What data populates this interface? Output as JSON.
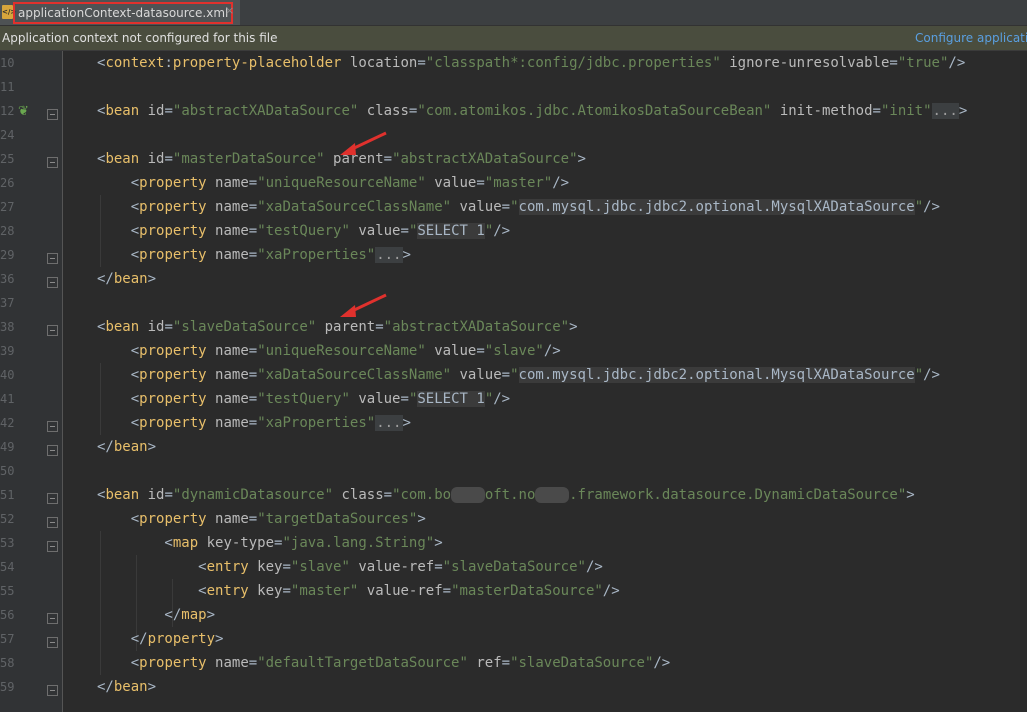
{
  "tab": {
    "icon": "xml-file-icon",
    "title": "applicationContext-datasource.xml",
    "close": "×"
  },
  "notice": {
    "text": "Application context not configured for this file",
    "link": "Configure applicatio"
  },
  "lines": [
    {
      "num": "10"
    },
    {
      "num": "11"
    },
    {
      "num": "12"
    },
    {
      "num": "24"
    },
    {
      "num": "25"
    },
    {
      "num": "26"
    },
    {
      "num": "27"
    },
    {
      "num": "28"
    },
    {
      "num": "29"
    },
    {
      "num": "36"
    },
    {
      "num": "37"
    },
    {
      "num": "38"
    },
    {
      "num": "39"
    },
    {
      "num": "40"
    },
    {
      "num": "41"
    },
    {
      "num": "42"
    },
    {
      "num": "49"
    },
    {
      "num": "50"
    },
    {
      "num": "51"
    },
    {
      "num": "52"
    },
    {
      "num": "53"
    },
    {
      "num": "54"
    },
    {
      "num": "55"
    },
    {
      "num": "56"
    },
    {
      "num": "57"
    },
    {
      "num": "58"
    },
    {
      "num": "59"
    }
  ],
  "code": {
    "placeholder": {
      "tag": "context",
      "name": "property-placeholder",
      "attr1": "location",
      "val1": "\"classpath*:config/jdbc.properties\"",
      "attr2": "ignore-unresolvable",
      "val2": "\"true\""
    },
    "abstract": {
      "id": "\"abstractXADataSource\"",
      "cls": "\"com.atomikos.jdbc.AtomikosDataSourceBean\"",
      "initMethod": "\"init\""
    },
    "master": {
      "id": "\"masterDataSource\"",
      "parent": "\"abstractXADataSource\"",
      "urn": "\"master\""
    },
    "slave": {
      "id": "\"slaveDataSource\"",
      "parent": "\"abstractXADataSource\"",
      "urn": "\"slave\""
    },
    "xaClass": "com.mysql.jdbc.jdbc2.optional.MysqlXADataSource",
    "testQuery": "SELECT 1",
    "dynamic": {
      "id": "\"dynamicDatasource\"",
      "clsPrefix": "\"com.bo",
      "blur1": "xxxx",
      "clsMid": "oft.no",
      "blur2": "xxxx",
      "clsSuffix": ".framework.datasource.DynamicDataSource\""
    },
    "targetDS": "\"targetDataSources\"",
    "keyType": "\"java.lang.String\"",
    "entrySlave": {
      "key": "\"slave\"",
      "ref": "\"slaveDataSource\""
    },
    "entryMaster": {
      "key": "\"master\"",
      "ref": "\"masterDataSource\""
    },
    "defaultTarget": {
      "name": "\"defaultTargetDataSource\"",
      "ref": "\"slaveDataSource\""
    },
    "kw": {
      "bean": "bean",
      "property": "property",
      "map": "map",
      "entry": "entry",
      "id": "id",
      "class": "class",
      "parent": "parent",
      "name": "name",
      "value": "value",
      "initMethod": "init-method",
      "keyType": "key-type",
      "key": "key",
      "valueRef": "value-ref",
      "ref": "ref",
      "uniqueResourceName": "\"uniqueResourceName\"",
      "xaDataSourceClassName": "\"xaDataSourceClassName\"",
      "testQueryName": "\"testQuery\"",
      "xaProperties": "\"xaProperties\"",
      "ellipsis": "..."
    }
  },
  "colors": {
    "tag": "#e8bf6a",
    "attr": "#bababa",
    "value": "#6a8759",
    "annotation_arrow": "#e0312d",
    "notice_bg": "#4a4d3e"
  }
}
